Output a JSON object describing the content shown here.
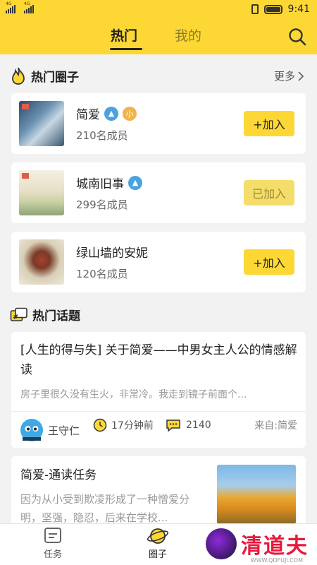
{
  "status": {
    "network_a": "4G",
    "network_b": "4G",
    "time": "9:41"
  },
  "tabs": {
    "hot": "热门",
    "mine": "我的"
  },
  "hot_circles": {
    "heading": "热门圈子",
    "more": "更多",
    "items": [
      {
        "name": "简爱",
        "badge_small": "小",
        "members": "210名成员",
        "action": "+加入"
      },
      {
        "name": "城南旧事",
        "members": "299名成员",
        "action": "已加入"
      },
      {
        "name": "绿山墙的安妮",
        "members": "120名成员",
        "action": "+加入"
      }
    ]
  },
  "hot_topics": {
    "heading": "热门话题",
    "items": [
      {
        "title": "[人生的得与失] 关于简爱——中男女主人公的情感解读",
        "excerpt": "房子里很久没有生火，非常冷。我走到镜子前面个...",
        "author": "王守仁",
        "time": "17分钟前",
        "comments": "2140",
        "source": "来自:简爱"
      },
      {
        "title": "简爱-通读任务",
        "excerpt": "因为从小受到欺凌形成了一种憎爱分明，坚强，隐忍，后来在学校..."
      }
    ]
  },
  "bottom_nav": {
    "task": "任务",
    "circle": "圈子"
  },
  "watermark": {
    "brand": "清道夫",
    "url": "WWW.QDFUJI.COM"
  },
  "colors": {
    "accent": "#fdd835",
    "joined": "#f4dd6a"
  }
}
